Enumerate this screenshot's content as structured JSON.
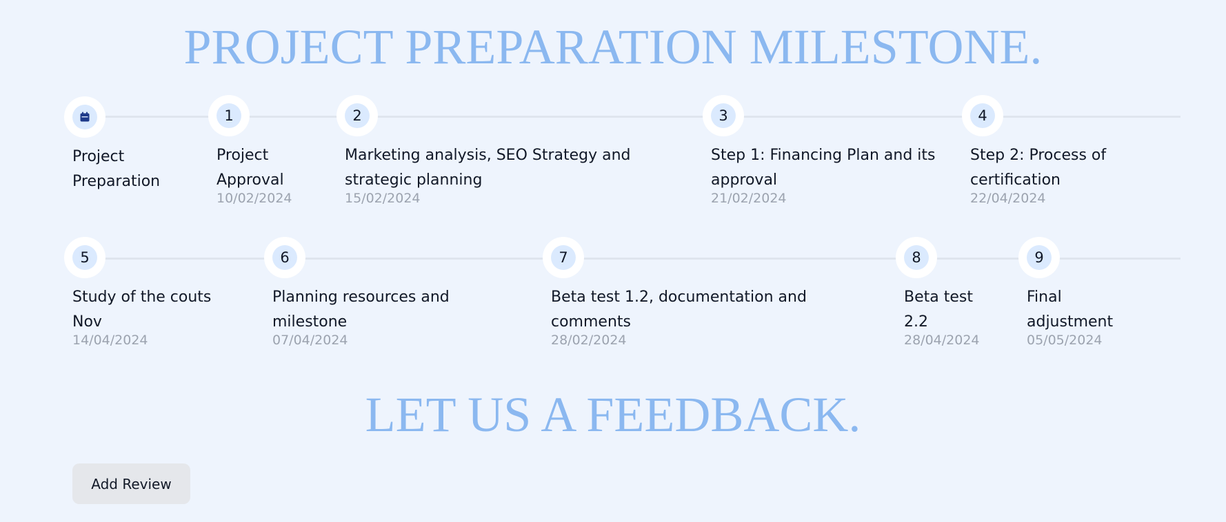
{
  "titles": {
    "milestone": "PROJECT PREPARATION MILESTONE.",
    "feedback": "LET US A FEEDBACK."
  },
  "colors": {
    "background": "#eef4fd",
    "heading": "#8bb8f0",
    "marker_fill": "#dbeafe",
    "calendar_icon": "#1e3a8a",
    "date_text": "#9ca3af",
    "button_bg": "#e5e7eb"
  },
  "timeline_row1": [
    {
      "marker": "calendar-icon",
      "title": "Project Preparation",
      "date": ""
    },
    {
      "marker": "1",
      "title": "Project Approval",
      "date": "10/02/2024"
    },
    {
      "marker": "2",
      "title": "Marketing analysis, SEO Strategy and strategic planning",
      "date": "15/02/2024"
    },
    {
      "marker": "3",
      "title": "Step 1: Financing Plan and its approval",
      "date": "21/02/2024"
    },
    {
      "marker": "4",
      "title": "Step 2: Process of certification",
      "date": "22/04/2024"
    }
  ],
  "timeline_row2": [
    {
      "marker": "5",
      "title": "Study of the couts Nov",
      "date": "14/04/2024"
    },
    {
      "marker": "6",
      "title": "Planning resources and milestone",
      "date": "07/04/2024"
    },
    {
      "marker": "7",
      "title": "Beta test 1.2, documentation and comments",
      "date": "28/02/2024"
    },
    {
      "marker": "8",
      "title": "Beta test 2.2",
      "date": "28/04/2024"
    },
    {
      "marker": "9",
      "title": "Final adjustment",
      "date": "05/05/2024"
    }
  ],
  "actions": {
    "add_review_label": "Add Review"
  }
}
